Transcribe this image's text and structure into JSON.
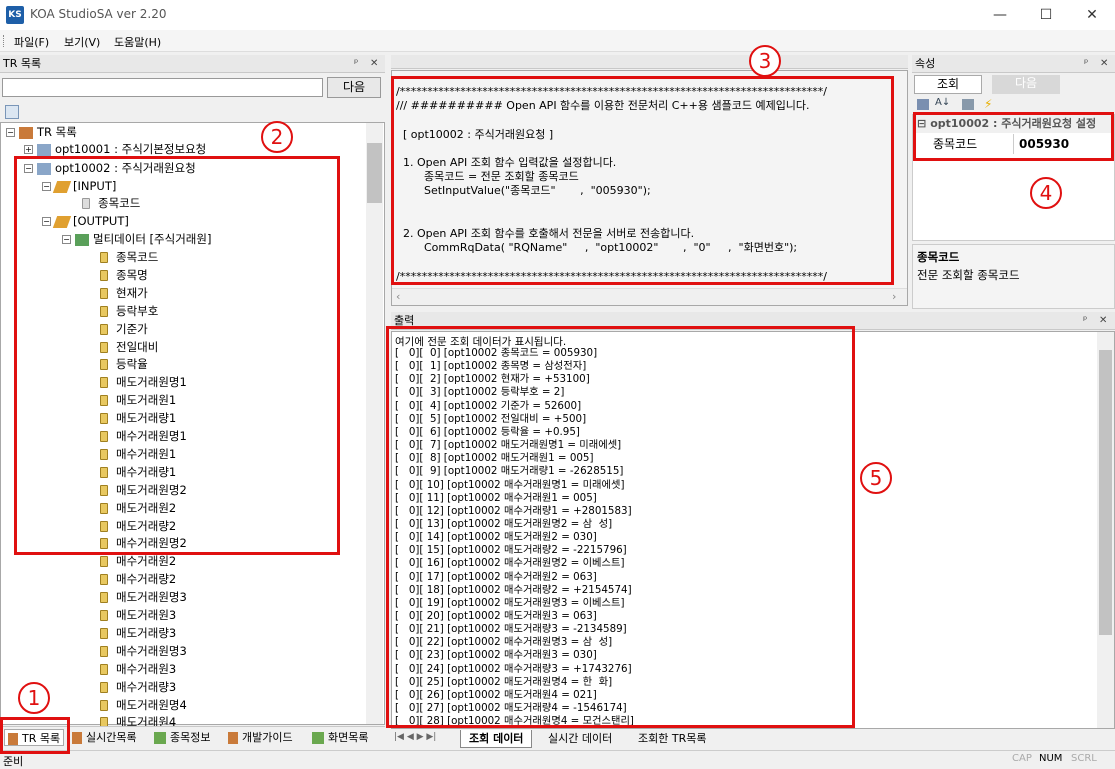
{
  "app": {
    "title": "KOA StudioSA ver 2.20",
    "icon": "KS"
  },
  "window": {
    "min": "—",
    "max": "☐",
    "close": "✕"
  },
  "menu": [
    "파일(F)",
    "보기(V)",
    "도움말(H)"
  ],
  "tr_panel": {
    "title": "TR 목록",
    "search_button": "다음",
    "search_value": ""
  },
  "tree": {
    "root": "TR 목록",
    "n1": "opt10001 : 주식기본정보요청",
    "n2": "opt10002 : 주식거래원요청",
    "input": "[INPUT]",
    "input_field": "종목코드",
    "output": "[OUTPUT]",
    "multi": "멀티데이터 [주식거래원]",
    "fields": [
      "종목코드",
      "종목명",
      "현재가",
      "등락부호",
      "기준가",
      "전일대비",
      "등락율",
      "매도거래원명1",
      "매도거래원1",
      "매도거래량1",
      "매수거래원명1",
      "매수거래원1",
      "매수거래량1",
      "매도거래원명2",
      "매도거래원2",
      "매도거래량2",
      "매수거래원명2",
      "매수거래원2",
      "매수거래량2",
      "매도거래원명3",
      "매도거래원3",
      "매도거래량3",
      "매수거래원명3",
      "매수거래원3",
      "매수거래량3",
      "매도거래원명4",
      "매도거래원4"
    ]
  },
  "left_tabs": [
    "TR 목록",
    "실시간목록",
    "종목정보",
    "개발가이드",
    "화면목록"
  ],
  "code": {
    "lines": [
      "/*****************************************************************************/",
      "/// ########## Open API 함수를 이용한 전문처리 C++용 샘플코드 예제입니다.",
      "",
      "  [ opt10002 : 주식거래원요청 ]",
      "",
      "  1. Open API 조회 함수 입력값을 설정합니다.",
      "        종목코드 = 전문 조회할 종목코드",
      "        SetInputValue(\"종목코드\"       ,  \"005930\");",
      "",
      "",
      "  2. Open API 조회 함수를 호출해서 전문을 서버로 전송합니다.",
      "        CommRqData( \"RQName\"     ,  \"opt10002\"       ,  \"0\"     ,  \"화면번호\");",
      "",
      "/*****************************************************************************/"
    ]
  },
  "props": {
    "title": "속성",
    "tab1": "조회",
    "tab2": "다음",
    "group": "opt10002 : 주식거래원요청 설정",
    "key": "종목코드",
    "value": "005930",
    "desc_title": "종목코드",
    "desc_text": "전문 조회할 종목코드"
  },
  "output": {
    "title": "출력",
    "header": "여기에 전문 조회 데이터가 표시됩니다.",
    "lines": [
      "[   0][  0] [opt10002 종목코드 = 005930]",
      "[   0][  1] [opt10002 종목명 = 삼성전자]",
      "[   0][  2] [opt10002 현재가 = +53100]",
      "[   0][  3] [opt10002 등락부호 = 2]",
      "[   0][  4] [opt10002 기준가 = 52600]",
      "[   0][  5] [opt10002 전일대비 = +500]",
      "[   0][  6] [opt10002 등락율 = +0.95]",
      "[   0][  7] [opt10002 매도거래원명1 = 미래에셋]",
      "[   0][  8] [opt10002 매도거래원1 = 005]",
      "[   0][  9] [opt10002 매도거래량1 = -2628515]",
      "[   0][ 10] [opt10002 매수거래원명1 = 미래에셋]",
      "[   0][ 11] [opt10002 매수거래원1 = 005]",
      "[   0][ 12] [opt10002 매수거래량1 = +2801583]",
      "[   0][ 13] [opt10002 매도거래원명2 = 삼  성]",
      "[   0][ 14] [opt10002 매도거래원2 = 030]",
      "[   0][ 15] [opt10002 매도거래량2 = -2215796]",
      "[   0][ 16] [opt10002 매수거래원명2 = 이베스트]",
      "[   0][ 17] [opt10002 매수거래원2 = 063]",
      "[   0][ 18] [opt10002 매수거래량2 = +2154574]",
      "[   0][ 19] [opt10002 매도거래원명3 = 이베스트]",
      "[   0][ 20] [opt10002 매도거래원3 = 063]",
      "[   0][ 21] [opt10002 매도거래량3 = -2134589]",
      "[   0][ 22] [opt10002 매수거래원명3 = 삼  성]",
      "[   0][ 23] [opt10002 매수거래원3 = 030]",
      "[   0][ 24] [opt10002 매수거래량3 = +1743276]",
      "[   0][ 25] [opt10002 매도거래원명4 = 한  화]",
      "[   0][ 26] [opt10002 매도거래원4 = 021]",
      "[   0][ 27] [opt10002 매도거래량4 = -1546174]",
      "[   0][ 28] [opt10002 매수거래원명4 = 모건스탠리]"
    ]
  },
  "bottom_tabs": [
    "조회 데이터",
    "실시간 데이터",
    "조회한 TR목록"
  ],
  "status": {
    "left": "준비",
    "cap": "CAP",
    "num": "NUM",
    "scrl": "SCRL"
  },
  "markers": [
    "1",
    "2",
    "3",
    "4",
    "5"
  ]
}
